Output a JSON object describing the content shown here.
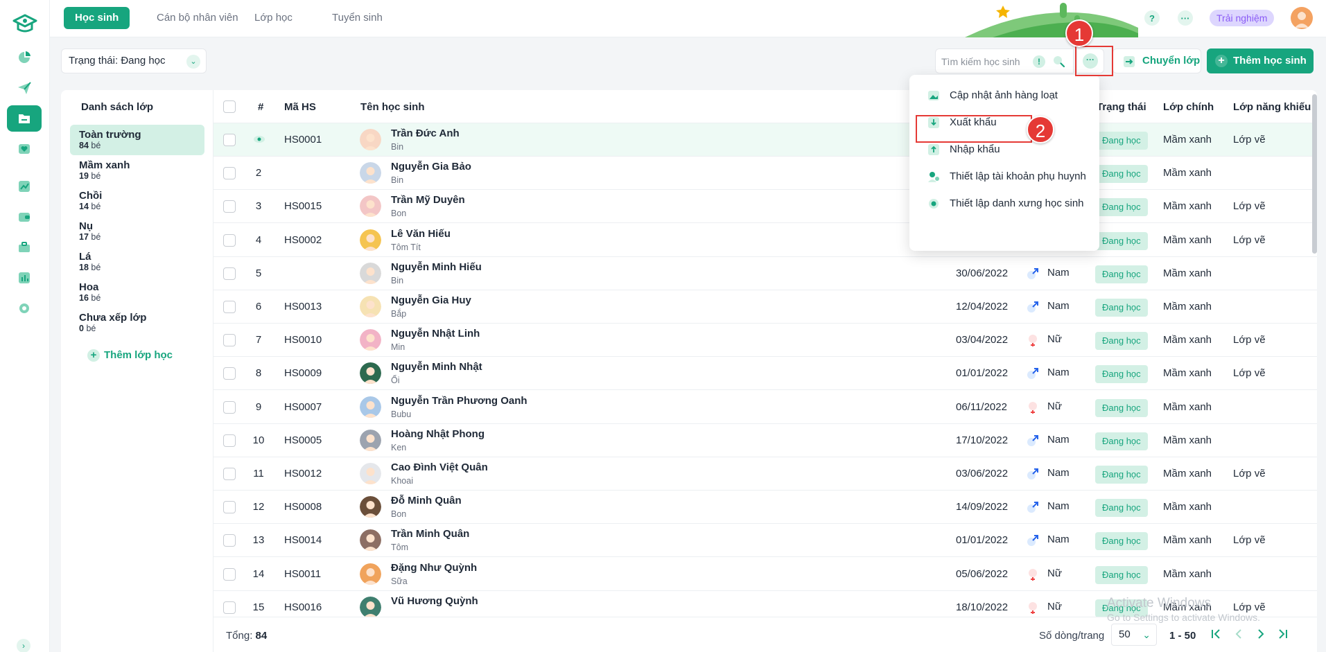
{
  "tabs": [
    {
      "label": "Học sinh",
      "active": true
    },
    {
      "label": "Cán bộ nhân viên",
      "active": false
    },
    {
      "label": "Lớp học",
      "active": false
    },
    {
      "label": "Tuyển sinh",
      "active": false
    }
  ],
  "header": {
    "help": "?",
    "more": "···",
    "trial": "Trải nghiệm"
  },
  "filter": {
    "status_label": "Trạng thái: Đang học",
    "search_placeholder": "Tìm kiếm học sinh",
    "info": "!",
    "more": "···",
    "move_class": "Chuyển lớp",
    "add_student": "Thêm học sinh"
  },
  "annotations": {
    "one": "1",
    "two": "2"
  },
  "class_list": {
    "title": "Danh sách lớp",
    "unit": "bé",
    "items": [
      {
        "name": "Toàn trường",
        "count": "84",
        "active": true
      },
      {
        "name": "Mầm xanh",
        "count": "19"
      },
      {
        "name": "Chồi",
        "count": "14"
      },
      {
        "name": "Nụ",
        "count": "17"
      },
      {
        "name": "Lá",
        "count": "18"
      },
      {
        "name": "Hoa",
        "count": "16"
      },
      {
        "name": "Chưa xếp lớp",
        "count": "0"
      }
    ],
    "add_class": "Thêm lớp học"
  },
  "table": {
    "headers": {
      "index": "#",
      "code": "Mã HS",
      "name": "Tên học sinh",
      "status": "Trạng thái",
      "main_class": "Lớp chính",
      "talent_class": "Lớp năng khiếu"
    },
    "rows": [
      {
        "idx": "",
        "code": "HS0001",
        "name": "Trần Đức Anh",
        "nick": "Bin",
        "dob": "",
        "gender": "",
        "status": "Đang học",
        "main": "Mầm xanh",
        "talent": "Lớp vẽ"
      },
      {
        "idx": "2",
        "code": "",
        "name": "Nguyễn Gia Bảo",
        "nick": "Bin",
        "dob": "",
        "gender": "",
        "status": "Đang học",
        "main": "Mầm xanh",
        "talent": ""
      },
      {
        "idx": "3",
        "code": "HS0015",
        "name": "Trần Mỹ Duyên",
        "nick": "Bon",
        "dob": "",
        "gender": "",
        "status": "Đang học",
        "main": "Mầm xanh",
        "talent": "Lớp vẽ"
      },
      {
        "idx": "4",
        "code": "HS0002",
        "name": "Lê Văn Hiếu",
        "nick": "Tôm Tít",
        "dob": "",
        "gender": "",
        "status": "Đang học",
        "main": "Mầm xanh",
        "talent": "Lớp vẽ"
      },
      {
        "idx": "5",
        "code": "",
        "name": "Nguyễn Minh Hiếu",
        "nick": "Bin",
        "dob": "30/06/2022",
        "gender": "Nam",
        "status": "Đang học",
        "main": "Mầm xanh",
        "talent": ""
      },
      {
        "idx": "6",
        "code": "HS0013",
        "name": "Nguyễn Gia Huy",
        "nick": "Bắp",
        "dob": "12/04/2022",
        "gender": "Nam",
        "status": "Đang học",
        "main": "Mầm xanh",
        "talent": ""
      },
      {
        "idx": "7",
        "code": "HS0010",
        "name": "Nguyễn Nhật Linh",
        "nick": "Min",
        "dob": "03/04/2022",
        "gender": "Nữ",
        "status": "Đang học",
        "main": "Mầm xanh",
        "talent": "Lớp vẽ"
      },
      {
        "idx": "8",
        "code": "HS0009",
        "name": "Nguyễn Minh Nhật",
        "nick": "Ổi",
        "dob": "01/01/2022",
        "gender": "Nam",
        "status": "Đang học",
        "main": "Mầm xanh",
        "talent": "Lớp vẽ"
      },
      {
        "idx": "9",
        "code": "HS0007",
        "name": "Nguyễn Trần Phương Oanh",
        "nick": "Bubu",
        "dob": "06/11/2022",
        "gender": "Nữ",
        "status": "Đang học",
        "main": "Mầm xanh",
        "talent": ""
      },
      {
        "idx": "10",
        "code": "HS0005",
        "name": "Hoàng Nhật Phong",
        "nick": "Ken",
        "dob": "17/10/2022",
        "gender": "Nam",
        "status": "Đang học",
        "main": "Mầm xanh",
        "talent": ""
      },
      {
        "idx": "11",
        "code": "HS0012",
        "name": "Cao Đình Việt Quân",
        "nick": "Khoai",
        "dob": "03/06/2022",
        "gender": "Nam",
        "status": "Đang học",
        "main": "Mầm xanh",
        "talent": "Lớp vẽ"
      },
      {
        "idx": "12",
        "code": "HS0008",
        "name": "Đỗ Minh Quân",
        "nick": "Bon",
        "dob": "14/09/2022",
        "gender": "Nam",
        "status": "Đang học",
        "main": "Mầm xanh",
        "talent": ""
      },
      {
        "idx": "13",
        "code": "HS0014",
        "name": "Trần Minh Quân",
        "nick": "Tôm",
        "dob": "01/01/2022",
        "gender": "Nam",
        "status": "Đang học",
        "main": "Mầm xanh",
        "talent": "Lớp vẽ"
      },
      {
        "idx": "14",
        "code": "HS0011",
        "name": "Đặng Như Quỳnh",
        "nick": "Sữa",
        "dob": "05/06/2022",
        "gender": "Nữ",
        "status": "Đang học",
        "main": "Mầm xanh",
        "talent": ""
      },
      {
        "idx": "15",
        "code": "HS0016",
        "name": "Vũ Hương Quỳnh",
        "nick": "",
        "dob": "18/10/2022",
        "gender": "Nữ",
        "status": "Đang học",
        "main": "Mầm xanh",
        "talent": "Lớp vẽ"
      }
    ]
  },
  "menu": {
    "items": [
      "Cập nhật ảnh hàng loạt",
      "Xuất khẩu",
      "Nhập khẩu",
      "Thiết lập tài khoản phụ huynh",
      "Thiết lập danh xưng học sinh"
    ]
  },
  "footer": {
    "total_label": "Tổng:",
    "total": "84",
    "rows_per_page_label": "Số dòng/trang",
    "rows_per_page": "50",
    "range": "1 - 50"
  },
  "watermark": {
    "line1": "Activate Windows",
    "line2": "Go to Settings to activate Windows."
  },
  "colors": {
    "accent": "#17a57e",
    "accent_light": "#d3f0e5",
    "annotation": "#e53935",
    "trial_bg": "#ddd6fe",
    "trial_text": "#8b5cf6"
  }
}
